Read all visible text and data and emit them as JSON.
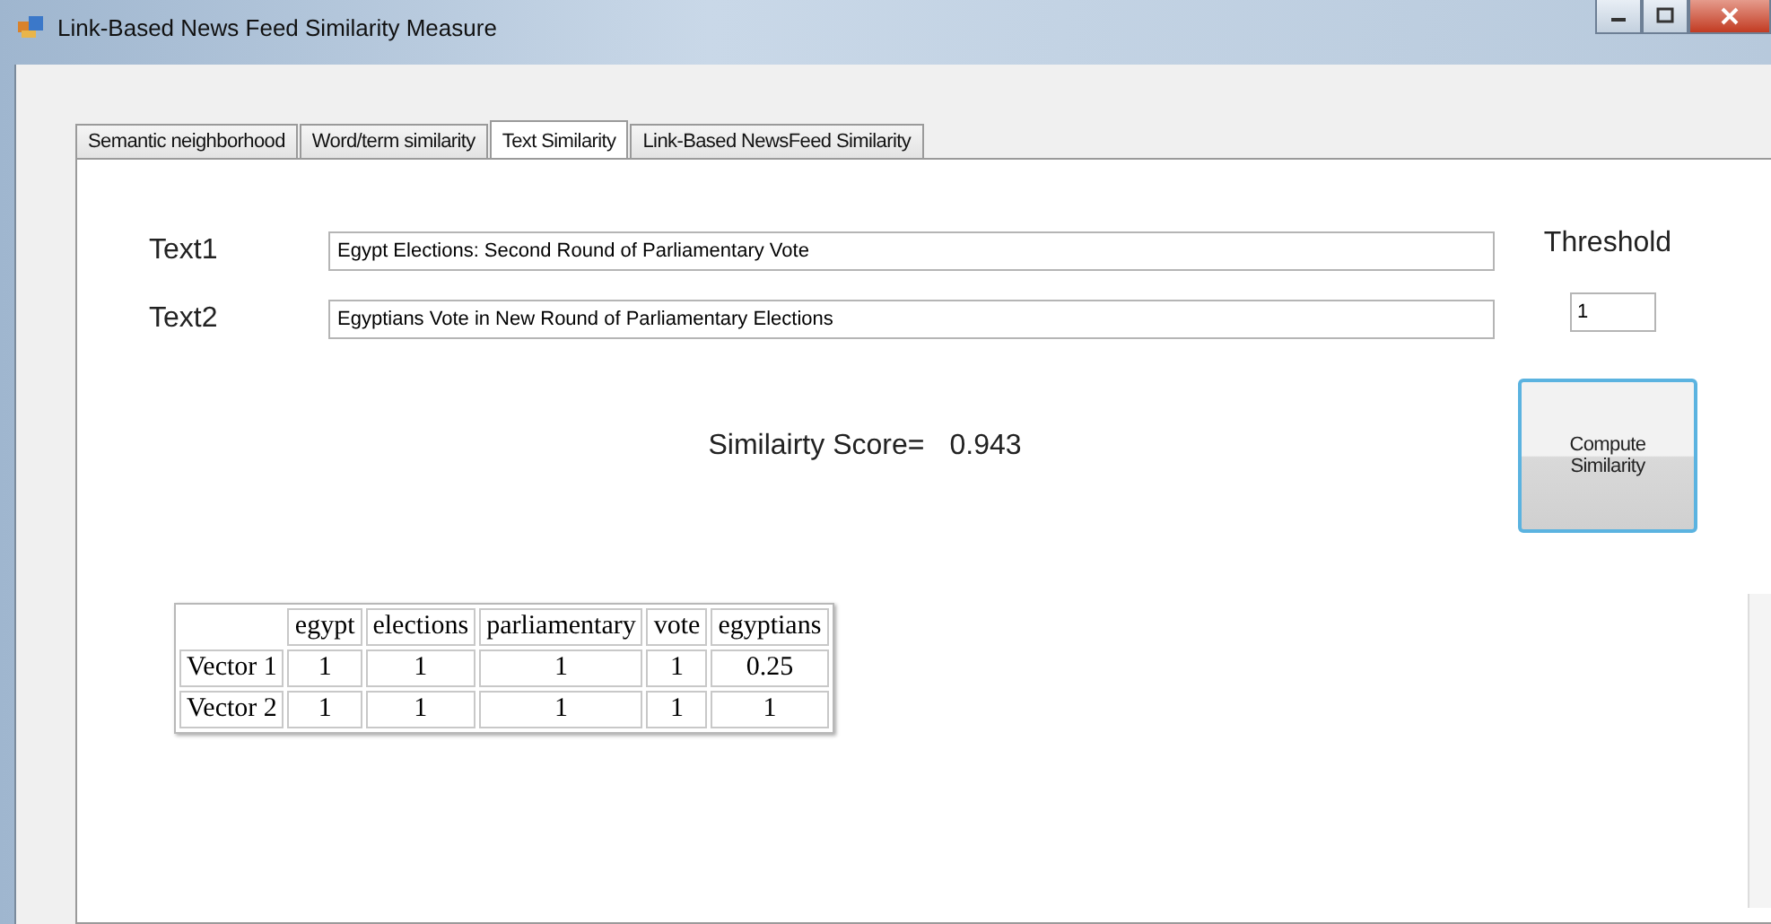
{
  "window": {
    "title": "Link-Based News Feed Similarity Measure"
  },
  "tabs": [
    {
      "label": "Semantic neighborhood",
      "selected": false
    },
    {
      "label": "Word/term similarity",
      "selected": false
    },
    {
      "label": "Text Similarity",
      "selected": true
    },
    {
      "label": "Link-Based NewsFeed Similarity",
      "selected": false
    }
  ],
  "fields": [
    {
      "label": "Text1",
      "value": "Egypt Elections: Second Round of Parliamentary Vote"
    },
    {
      "label": "Text2",
      "value": "Egyptians Vote in New Round of Parliamentary Elections"
    }
  ],
  "threshold": {
    "label": "Threshold",
    "value": "1"
  },
  "compute_button": "Compute Similarity",
  "score": {
    "label": "Similairty Score=",
    "value": "0.943"
  },
  "table": {
    "columns": [
      "",
      "egypt",
      "elections",
      "parliamentary",
      "vote",
      "egyptians"
    ],
    "rows": [
      [
        "Vector 1",
        "1",
        "1",
        "1",
        "1",
        "0.25"
      ],
      [
        "Vector 2",
        "1",
        "1",
        "1",
        "1",
        "1"
      ]
    ]
  }
}
